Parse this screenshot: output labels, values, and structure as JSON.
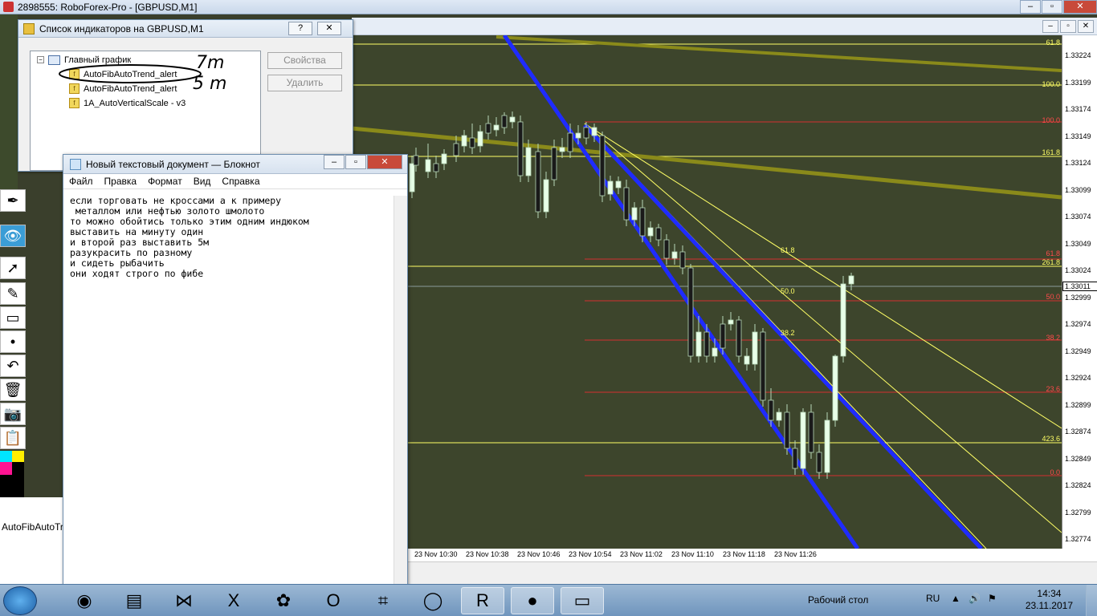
{
  "window": {
    "title": "2898555: RoboForex-Pro - [GBPUSD,M1]"
  },
  "indicator_dialog": {
    "title": "Список индикаторов на GBPUSD,M1",
    "help_label": "?",
    "close_label": "✕",
    "root_label": "Главный график",
    "items": [
      {
        "label": "AutoFibAutoTrend_alert"
      },
      {
        "label": "AutoFibAutoTrend_alert"
      },
      {
        "label": "1A_AutoVerticalScale - v3"
      }
    ],
    "buttons": {
      "properties": "Свойства",
      "delete": "Удалить"
    },
    "annotations": [
      "7m",
      "5 m"
    ]
  },
  "notepad": {
    "title": "Новый текстовый документ — Блокнот",
    "menu": [
      "Файл",
      "Правка",
      "Формат",
      "Вид",
      "Справка"
    ],
    "content": "если торговать не кроссами а к примеру\n металлом или нефтью золото шмолото\nто можно обойтись только этим одним индюком\nвыставить на минуту один\nи второй раз выставить 5м\nразукрасить по разному\nи сидеть рыбачить\nони ходят строго по фибе"
  },
  "chart": {
    "symbol": "GBPUSD,M1",
    "price_ticks": [
      "1.33224",
      "1.33199",
      "1.33174",
      "1.33149",
      "1.33124",
      "1.33099",
      "1.33074",
      "1.33049",
      "1.33024",
      "1.32999",
      "1.32974",
      "1.32949",
      "1.32924",
      "1.32899",
      "1.32874",
      "1.32849",
      "1.32824",
      "1.32799",
      "1.32774"
    ],
    "current_price": "1.33011",
    "time_ticks": [
      "23 Nov 10:30",
      "23 Nov 10:38",
      "23 Nov 10:46",
      "23 Nov 10:54",
      "23 Nov 11:02",
      "23 Nov 11:10",
      "23 Nov 11:18",
      "23 Nov 11:26"
    ],
    "fib_labels_right": [
      {
        "text": "61.8",
        "color": "yellow"
      },
      {
        "text": "100.0",
        "color": "yellow"
      },
      {
        "text": "100.0",
        "color": "red"
      },
      {
        "text": "161.8",
        "color": "yellow"
      },
      {
        "text": "61.8",
        "color": "red"
      },
      {
        "text": "261.8",
        "color": "yellow"
      },
      {
        "text": "50.0",
        "color": "red"
      },
      {
        "text": "38.2",
        "color": "red"
      },
      {
        "text": "23.6",
        "color": "red"
      },
      {
        "text": "423.6",
        "color": "yellow"
      },
      {
        "text": "0.0",
        "color": "red"
      }
    ],
    "fib_labels_inner": [
      "61.8",
      "50.0",
      "38.2"
    ],
    "colors": {
      "bg": "#3d452c",
      "blue_channel": "#1f2bff",
      "fib_yellow": "#ffff66",
      "fib_red": "#d43030",
      "bull": "#e8ffe8",
      "bear": "#1a1a1a",
      "wick": "#b8d8b8"
    }
  },
  "left_panel": {
    "terminal_label": "AutoFibAutoTren"
  },
  "taskbar": {
    "desktop_label": "Рабочий стол",
    "lang": "RU",
    "time": "14:34",
    "date": "23.11.2017"
  }
}
